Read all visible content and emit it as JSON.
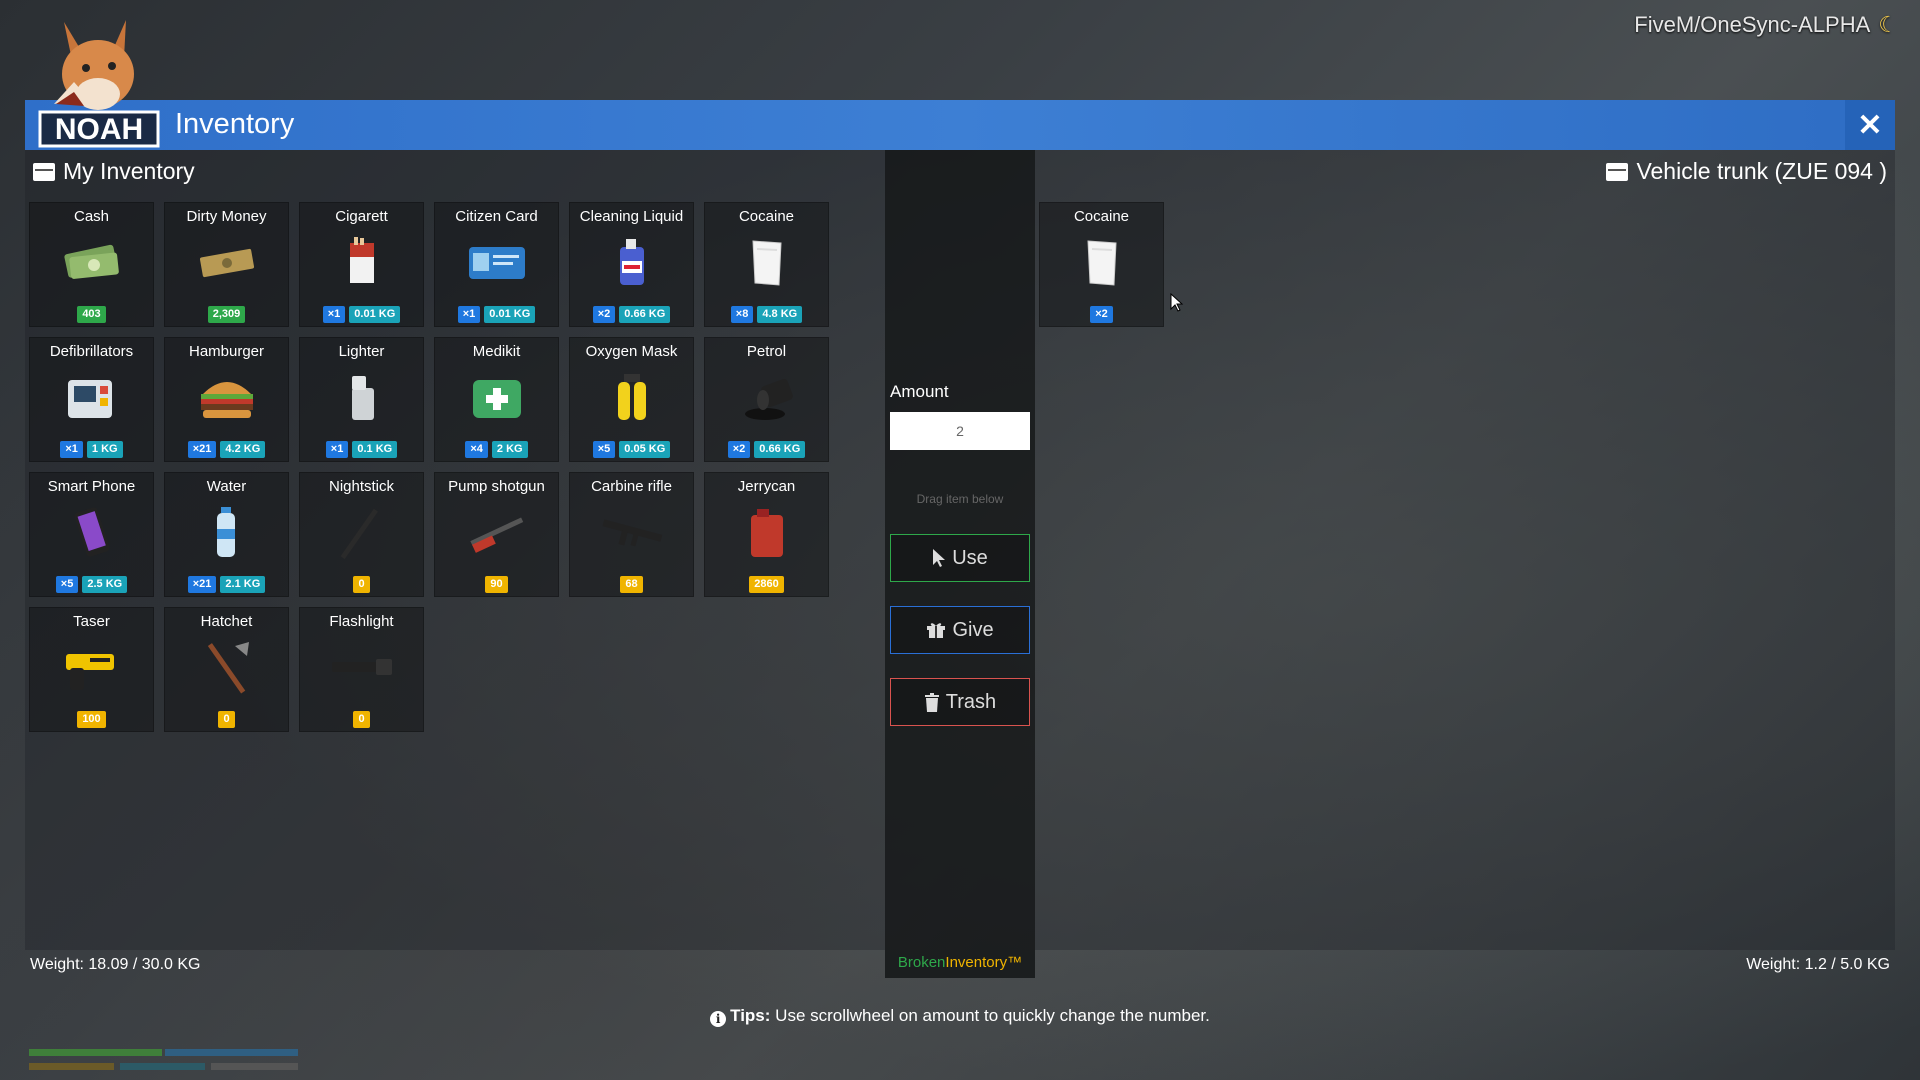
{
  "server_label": "FiveM/OneSync-ALPHA",
  "window": {
    "title": "Inventory",
    "close_label": "✕"
  },
  "left": {
    "title": "My Inventory",
    "weight": "Weight: 18.09 / 30.0 KG",
    "items": [
      {
        "name": "Cash",
        "icon": "cash-icon",
        "badges": [
          {
            "t": "403",
            "c": "green"
          }
        ]
      },
      {
        "name": "Dirty Money",
        "icon": "dirty-money-icon",
        "badges": [
          {
            "t": "2,309",
            "c": "green"
          }
        ]
      },
      {
        "name": "Cigarett",
        "icon": "cigarette-pack-icon",
        "badges": [
          {
            "t": "×1",
            "c": "blue"
          },
          {
            "t": "0.01 KG",
            "c": "teal"
          }
        ]
      },
      {
        "name": "Citizen Card",
        "icon": "id-card-icon",
        "badges": [
          {
            "t": "×1",
            "c": "blue"
          },
          {
            "t": "0.01 KG",
            "c": "teal"
          }
        ]
      },
      {
        "name": "Cleaning Liquid",
        "icon": "cleaning-liquid-icon",
        "badges": [
          {
            "t": "×2",
            "c": "blue"
          },
          {
            "t": "0.66 KG",
            "c": "teal"
          }
        ]
      },
      {
        "name": "Cocaine",
        "icon": "cocaine-bag-icon",
        "badges": [
          {
            "t": "×8",
            "c": "blue"
          },
          {
            "t": "4.8 KG",
            "c": "teal"
          }
        ]
      },
      {
        "name": "Defibrillators",
        "icon": "defibrillator-icon",
        "badges": [
          {
            "t": "×1",
            "c": "blue"
          },
          {
            "t": "1 KG",
            "c": "teal"
          }
        ]
      },
      {
        "name": "Hamburger",
        "icon": "hamburger-icon",
        "badges": [
          {
            "t": "×21",
            "c": "blue"
          },
          {
            "t": "4.2 KG",
            "c": "teal"
          }
        ]
      },
      {
        "name": "Lighter",
        "icon": "lighter-icon",
        "badges": [
          {
            "t": "×1",
            "c": "blue"
          },
          {
            "t": "0.1 KG",
            "c": "teal"
          }
        ]
      },
      {
        "name": "Medikit",
        "icon": "medikit-icon",
        "badges": [
          {
            "t": "×4",
            "c": "blue"
          },
          {
            "t": "2 KG",
            "c": "teal"
          }
        ]
      },
      {
        "name": "Oxygen Mask",
        "icon": "oxygen-tank-icon",
        "badges": [
          {
            "t": "×5",
            "c": "blue"
          },
          {
            "t": "0.05 KG",
            "c": "teal"
          }
        ]
      },
      {
        "name": "Petrol",
        "icon": "oil-barrel-icon",
        "badges": [
          {
            "t": "×2",
            "c": "blue"
          },
          {
            "t": "0.66 KG",
            "c": "teal"
          }
        ]
      },
      {
        "name": "Smart Phone",
        "icon": "smartphone-icon",
        "badges": [
          {
            "t": "×5",
            "c": "blue"
          },
          {
            "t": "2.5 KG",
            "c": "teal"
          }
        ]
      },
      {
        "name": "Water",
        "icon": "water-bottle-icon",
        "badges": [
          {
            "t": "×21",
            "c": "blue"
          },
          {
            "t": "2.1 KG",
            "c": "teal"
          }
        ]
      },
      {
        "name": "Nightstick",
        "icon": "nightstick-icon",
        "badges": [
          {
            "t": "0",
            "c": "yellow"
          }
        ]
      },
      {
        "name": "Pump shotgun",
        "icon": "shotgun-icon",
        "badges": [
          {
            "t": "90",
            "c": "yellow"
          }
        ]
      },
      {
        "name": "Carbine rifle",
        "icon": "rifle-icon",
        "badges": [
          {
            "t": "68",
            "c": "yellow"
          }
        ]
      },
      {
        "name": "Jerrycan",
        "icon": "jerrycan-icon",
        "badges": [
          {
            "t": "2860",
            "c": "yellow"
          }
        ]
      },
      {
        "name": "Taser",
        "icon": "taser-icon",
        "badges": [
          {
            "t": "100",
            "c": "yellow"
          }
        ]
      },
      {
        "name": "Hatchet",
        "icon": "hatchet-icon",
        "badges": [
          {
            "t": "0",
            "c": "yellow"
          }
        ]
      },
      {
        "name": "Flashlight",
        "icon": "flashlight-icon",
        "badges": [
          {
            "t": "0",
            "c": "yellow"
          }
        ]
      }
    ]
  },
  "right": {
    "title": "Vehicle trunk (ZUE 094 )",
    "weight": "Weight: 1.2 / 5.0 KG",
    "items": [
      {
        "name": "Cocaine",
        "icon": "cocaine-bag-icon",
        "badges": [
          {
            "t": "×2",
            "c": "blue"
          }
        ]
      }
    ]
  },
  "actions": {
    "amount_label": "Amount",
    "amount_value": "2",
    "drag_hint": "Drag item below",
    "use": "Use",
    "give": "Give",
    "trash": "Trash",
    "brand_a": "Broken",
    "brand_b": "Inventory™"
  },
  "tips": {
    "label": "Tips:",
    "text": " Use scrollwheel on amount to quickly change the number."
  },
  "colors": {
    "title_bar": "#2f6fc9",
    "green": "#2ea84a",
    "blue": "#1f78e0",
    "teal": "#1aa3b8",
    "yellow": "#f0b400",
    "red": "#d9534f"
  }
}
